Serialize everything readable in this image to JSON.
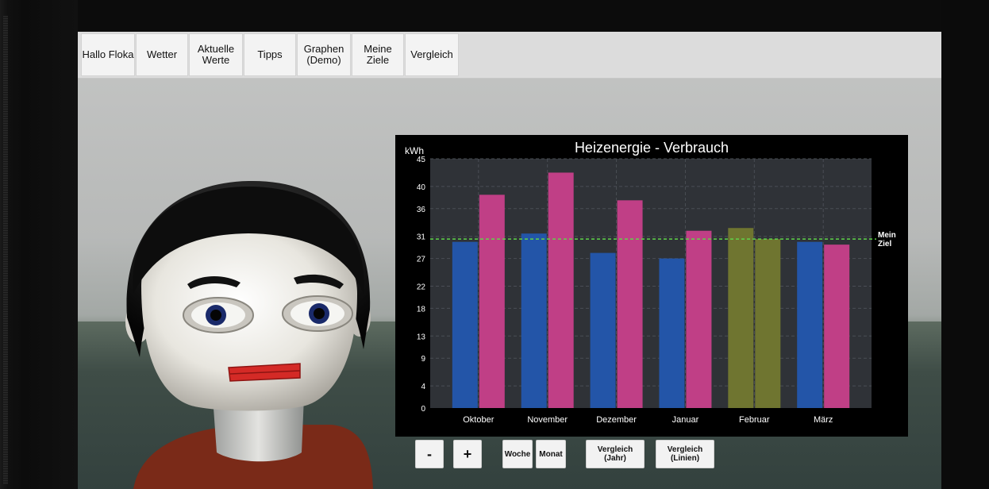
{
  "tabs": [
    {
      "label": "Hallo Floka"
    },
    {
      "label": "Wetter"
    },
    {
      "label": "Aktuelle\nWerte"
    },
    {
      "label": "Tipps"
    },
    {
      "label": "Graphen\n(Demo)"
    },
    {
      "label": "Meine\nZiele"
    },
    {
      "label": "Vergleich"
    }
  ],
  "controls": {
    "minus": "-",
    "plus": "+",
    "woche": "Woche",
    "monat": "Monat",
    "vergleich_jahr": "Vergleich\n(Jahr)",
    "vergleich_linien": "Vergleich\n(Linien)"
  },
  "chart_data": {
    "type": "bar",
    "title": "Heizenergie - Verbrauch",
    "ylabel": "kWh",
    "xlabel": "",
    "ylim": [
      0,
      45
    ],
    "yticks": [
      0,
      4,
      9,
      13,
      18,
      22,
      27,
      31,
      36,
      40,
      45
    ],
    "categories": [
      "Oktober",
      "November",
      "Dezember",
      "Januar",
      "Februar",
      "März"
    ],
    "series": [
      {
        "values": [
          30,
          31.5,
          28,
          27,
          32.5,
          30
        ],
        "colors": [
          "#2355a8",
          "#2355a8",
          "#2355a8",
          "#2355a8",
          "#6f7530",
          "#2355a8"
        ]
      },
      {
        "values": [
          38.5,
          42.5,
          37.5,
          32,
          30.5,
          29.5
        ],
        "colors": [
          "#c03f86",
          "#c03f86",
          "#c03f86",
          "#c03f86",
          "#6f7530",
          "#c03f86"
        ]
      }
    ],
    "goal": {
      "value": 30.5,
      "label": "Mein\nZiel",
      "color": "#5fd44a"
    },
    "grid": true,
    "background": "#2f3237"
  }
}
